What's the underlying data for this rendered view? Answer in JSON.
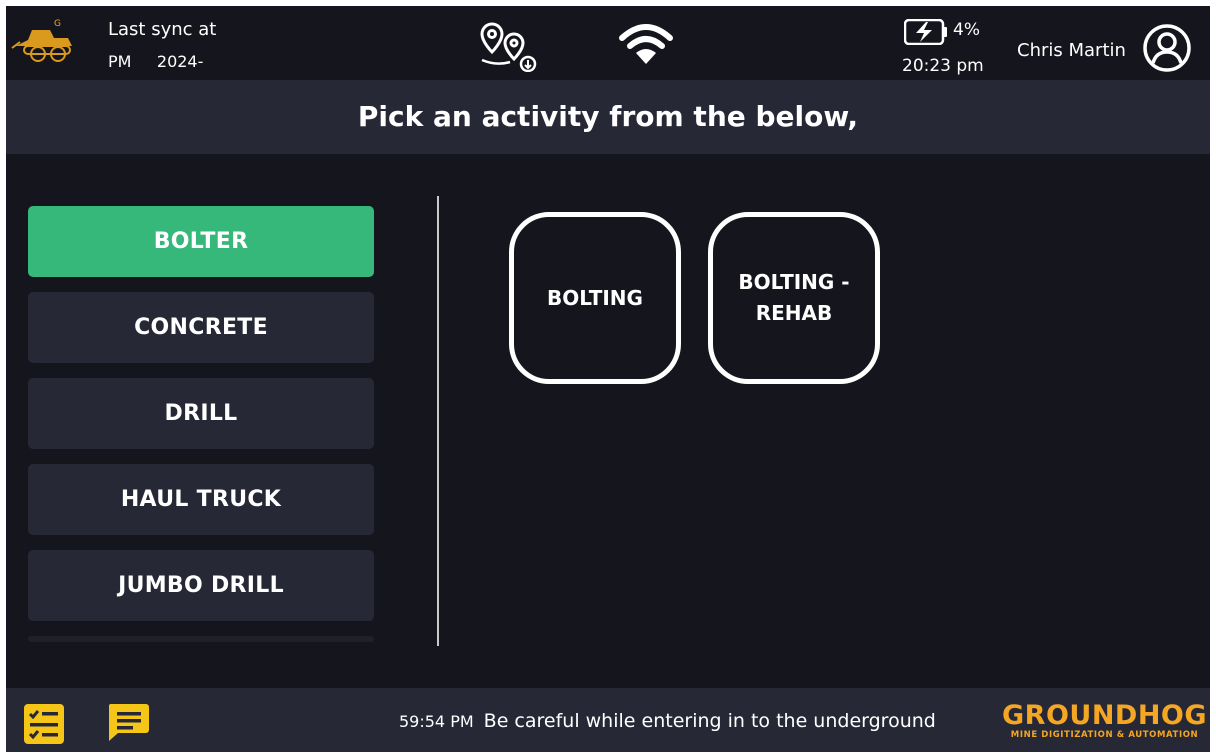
{
  "header": {
    "sync_label": "Last sync at",
    "sync_time_fragment": "PM",
    "sync_date_fragment": "2024-",
    "battery_percent": "4%",
    "clock": "20:23 pm",
    "user_name": "Chris Martin",
    "logo_letter": "G"
  },
  "prompt": {
    "title": "Pick an activity from the below,"
  },
  "categories": [
    {
      "label": "BOLTER",
      "active": true
    },
    {
      "label": "CONCRETE",
      "active": false
    },
    {
      "label": "DRILL",
      "active": false
    },
    {
      "label": "HAUL TRUCK",
      "active": false
    },
    {
      "label": "JUMBO DRILL",
      "active": false
    }
  ],
  "activities": [
    {
      "label": "BOLTING"
    },
    {
      "label": "BOLTING - REHAB"
    }
  ],
  "footer": {
    "ticker_time": "59:54 PM",
    "ticker_message": "Be careful while entering in to the underground",
    "brand_name": "GROUNDHOG",
    "brand_tagline": "MINE DIGITIZATION & AUTOMATION"
  },
  "colors": {
    "background": "#15151d",
    "bar": "#272836",
    "active_category": "#36b87a",
    "brand": "#f5a623"
  },
  "icons": {
    "logo": "mining-loader-logo-icon",
    "route": "route-pins-icon",
    "wifi": "wifi-icon",
    "battery": "battery-charging-icon",
    "avatar": "user-avatar-icon",
    "checklist": "checklist-icon",
    "chat": "chat-icon"
  }
}
